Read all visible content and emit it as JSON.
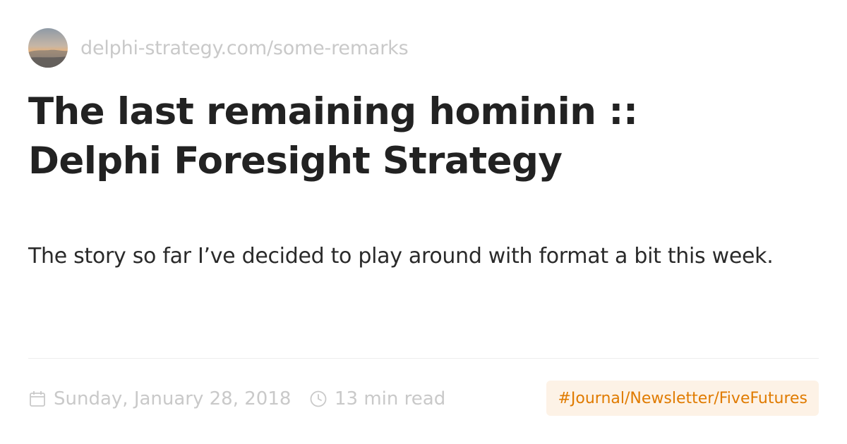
{
  "source": {
    "url": "delphi-strategy.com/some-remarks",
    "avatar_icon": "sunset-landscape-avatar"
  },
  "article": {
    "title_line1": "The last remaining hominin ::",
    "title_line2": "Delphi Foresight Strategy",
    "description": "The story so far I’ve decided to play around with format a bit this week."
  },
  "meta": {
    "date_icon": "calendar-icon",
    "date": "Sunday, January 28, 2018",
    "read_icon": "clock-icon",
    "read_time": "13 min read",
    "tag": "#Journal/Newsletter/FiveFutures"
  },
  "colors": {
    "title": "#222222",
    "muted": "#c9c9c9",
    "tag_text": "#e07b00",
    "tag_background": "#fdf2e6",
    "divider": "#ededed"
  }
}
